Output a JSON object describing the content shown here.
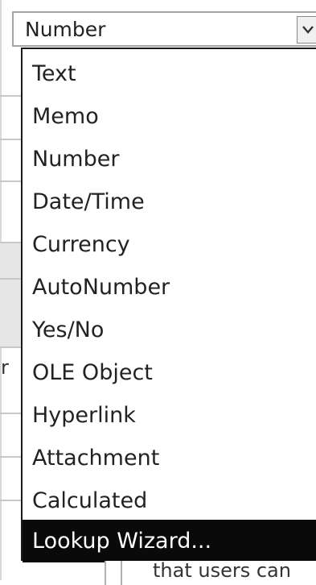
{
  "field_type_combo": {
    "value": "Number"
  },
  "dropdown": {
    "options": [
      "Text",
      "Memo",
      "Number",
      "Date/Time",
      "Currency",
      "AutoNumber",
      "Yes/No",
      "OLE Object",
      "Hyperlink",
      "Attachment",
      "Calculated",
      "Lookup Wizard..."
    ],
    "selected_index": 11
  },
  "background": {
    "row_fragment": "r",
    "description_fragment": "that users can"
  },
  "icons": {
    "combo_arrow": "chevron-down-icon"
  },
  "colors": {
    "selection_bg": "#0a0a0a",
    "selection_text": "#ffffff"
  }
}
